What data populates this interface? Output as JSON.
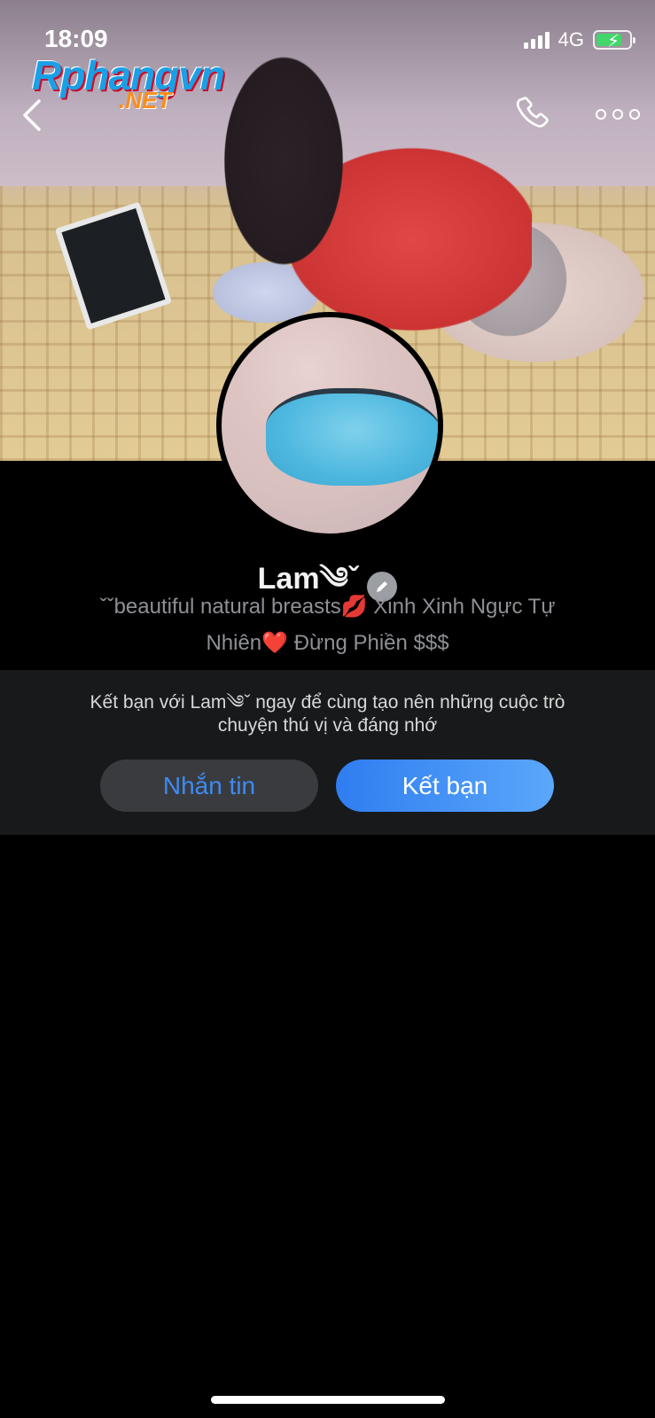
{
  "status_bar": {
    "time": "18:09",
    "network": "4G",
    "battery_charging": true
  },
  "watermark": {
    "main": "Rphangvn",
    "suffix": ".NET"
  },
  "header": {
    "back_icon": "chevron-left-icon",
    "call_icon": "phone-icon",
    "more_icon": "more-horizontal-icon"
  },
  "profile": {
    "name": "Lam༄ˇ",
    "edit_icon": "pencil-icon",
    "bio_line1": "ˇˇbeautiful natural breasts💋  Xinh Xinh Ngực Tự",
    "bio_line2": "Nhiên❤️ Đừng Phiền $$$"
  },
  "friend_panel": {
    "prompt_line1": "Kết bạn với Lam༄ˇ ngay để cùng tạo nên những cuộc trò",
    "prompt_line2": "chuyện thú vị và đáng nhớ",
    "message_button": "Nhắn tin",
    "add_friend_button": "Kết bạn"
  },
  "colors": {
    "accent": "#3d8bf2",
    "panel_bg": "#18191b",
    "background": "#000000"
  }
}
